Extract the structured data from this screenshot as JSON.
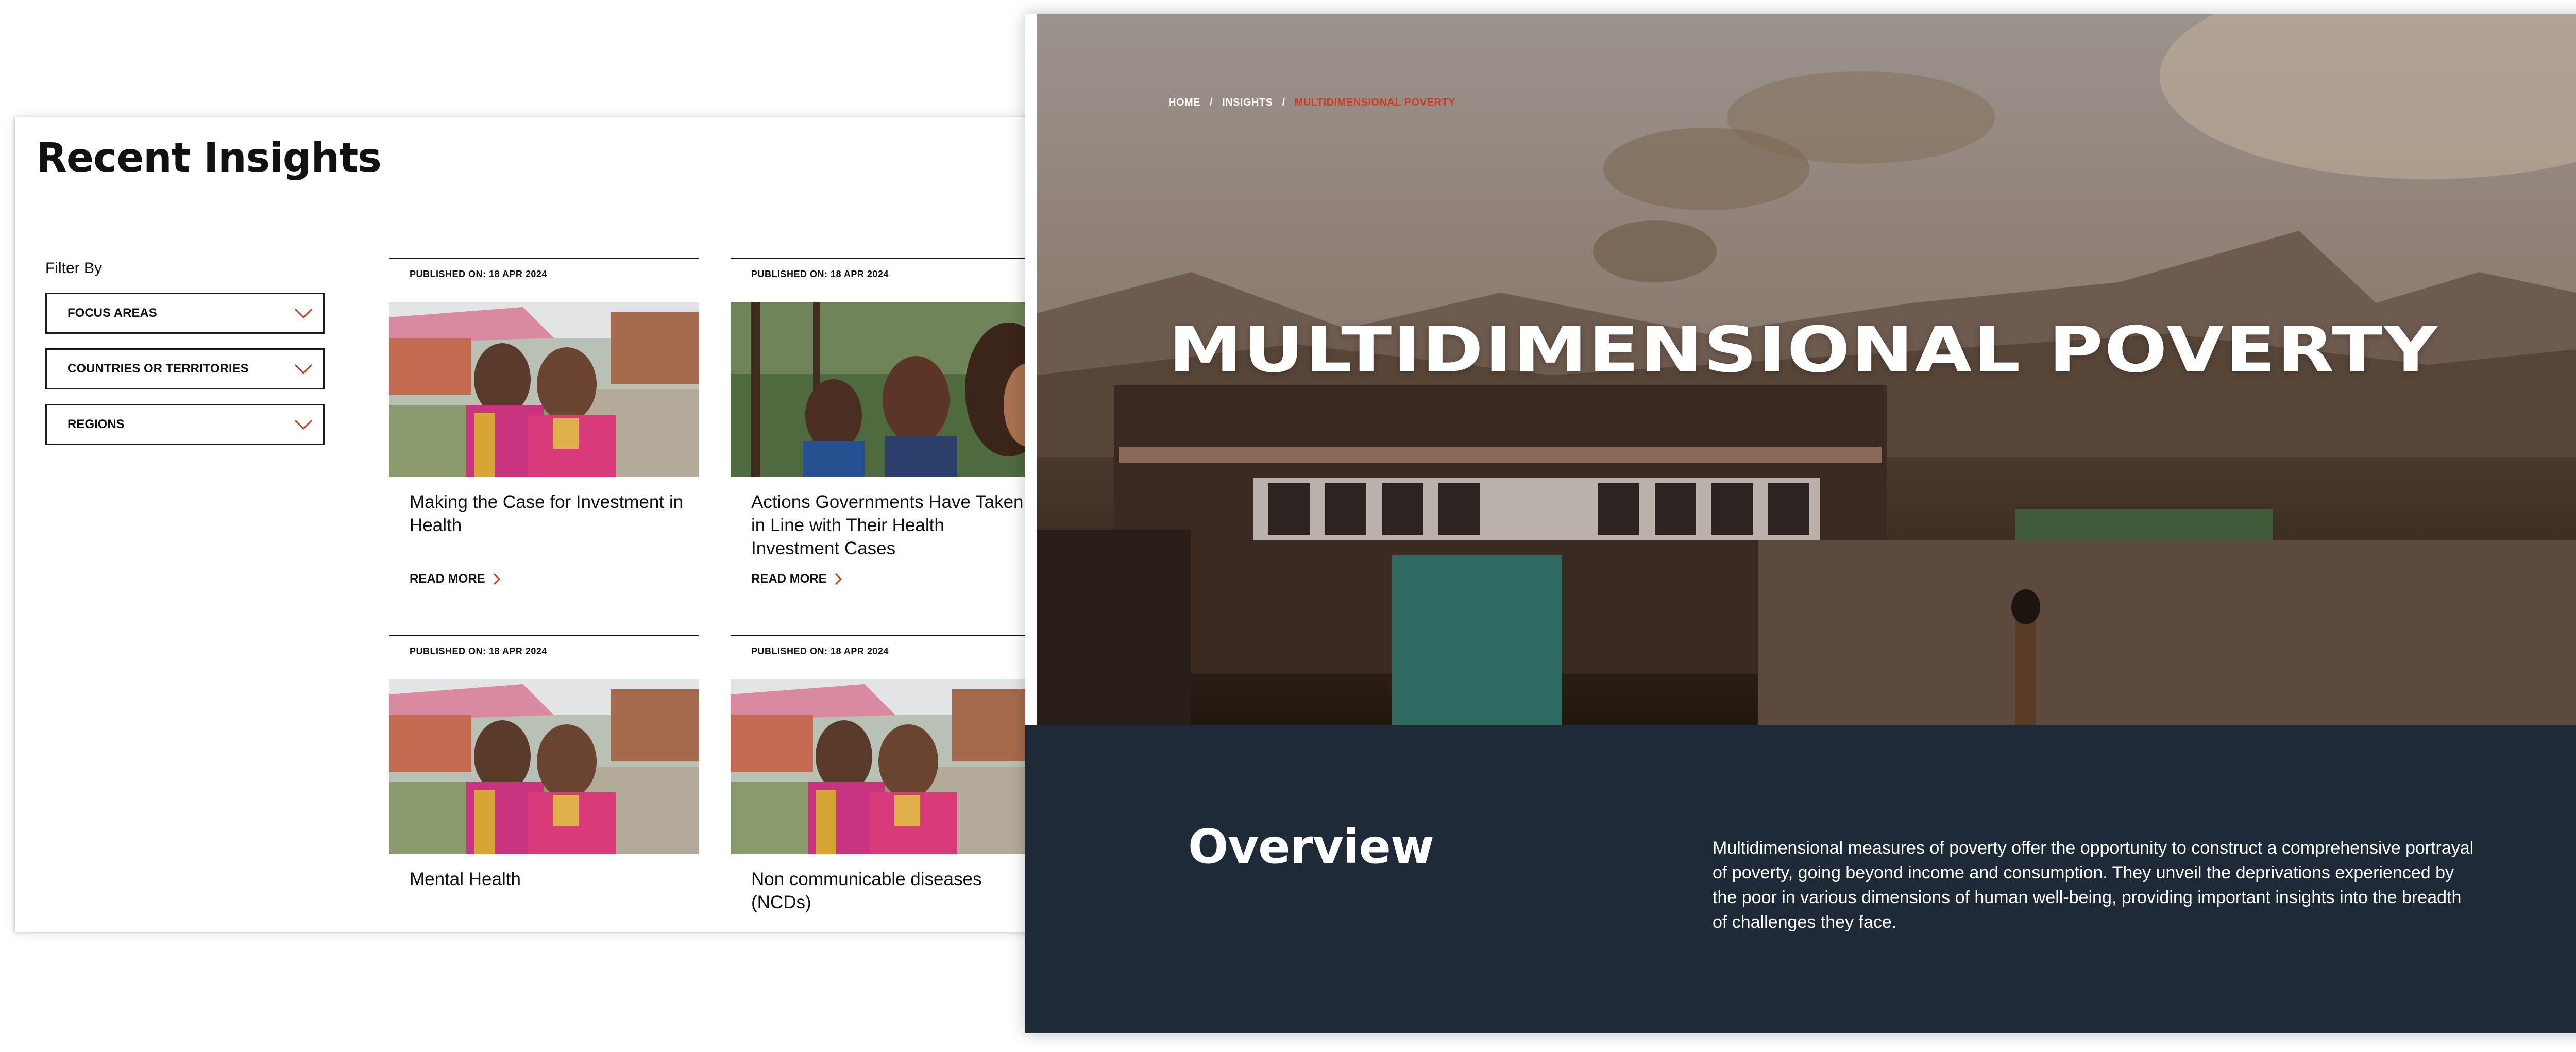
{
  "insights": {
    "title": "Recent Insights",
    "filter_label": "Filter By",
    "filters": [
      {
        "label": "FOCUS AREAS"
      },
      {
        "label": "COUNTRIES OR TERRITORIES"
      },
      {
        "label": "REGIONS"
      }
    ],
    "read_more_label": "READ MORE",
    "cards": [
      {
        "date": "PUBLISHED ON: 18 APR 2024",
        "title": "Making the Case for Investment in Health",
        "image": "two-women-smiling-photo"
      },
      {
        "date": "PUBLISHED ON: 18 APR 2024",
        "title": "Actions Governments Have Taken in Line with Their Health Investment Cases",
        "image": "three-women-profile-photo"
      },
      {
        "date": "PUBLISHED ON: 18 APR 2024",
        "title": "Mental Health",
        "image": "two-women-smiling-photo"
      },
      {
        "date": "PUBLISHED ON: 18 APR 2024",
        "title": "Non communicable diseases (NCDs)",
        "image": "two-women-smiling-photo"
      }
    ]
  },
  "poverty": {
    "breadcrumb": {
      "home": "HOME",
      "sep": "/",
      "insights": "INSIGHTS",
      "current": "MULTIDIMENSIONAL POVERTY"
    },
    "hero_title": "MULTIDIMENSIONAL POVERTY",
    "overview_title": "Overview",
    "overview_text": "Multidimensional measures of poverty offer the opportunity to construct a comprehensive portrayal of poverty, going beyond income and consumption. They unveil the deprivations experienced by the poor in various dimensions of human well-being, providing important insights into the breadth of challenges they face."
  },
  "colors": {
    "accent": "#d23a1f",
    "overview_bg": "#1f2a38"
  }
}
